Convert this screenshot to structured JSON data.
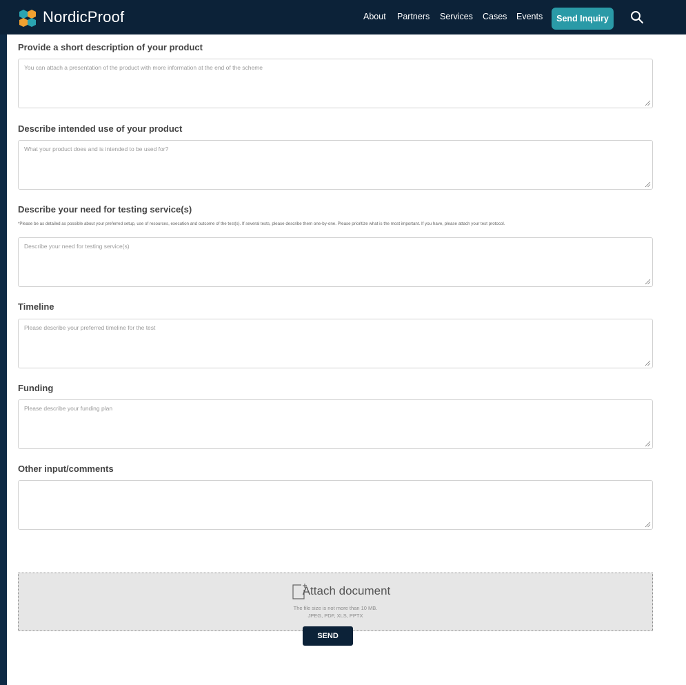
{
  "header": {
    "brand": "NordicProof",
    "nav": [
      "About",
      "Partners",
      "Services",
      "Cases",
      "Events"
    ],
    "cta_label": "Send Inquiry",
    "icons": {
      "logo": "nordicproof-logo-icon",
      "search": "search-icon"
    },
    "colors": {
      "header_bg": "#0c2238",
      "cta_bg": "#2a9aa7",
      "logo_teal": "#2aa4b1",
      "logo_orange": "#f0a030"
    }
  },
  "form": {
    "product_description": {
      "label": "Provide a short description of your product",
      "placeholder": "You can attach a presentation of the product with more information at the end of the scheme",
      "value": ""
    },
    "intended_use": {
      "label": "Describe intended use of your product",
      "placeholder": "What your product does and is intended to be used for?",
      "value": ""
    },
    "testing_need": {
      "label": "Describe your need for testing service(s)",
      "hint": "*Please be as detailed as possible about your preferred setup, use of resources, execution and outcome of the test(s). If several tests, please describe them one-by-one. Please prioritize what is the most important. If you have, please attach your test protocol.",
      "placeholder": "Describe your need for testing service(s)",
      "value": ""
    },
    "timeline": {
      "label": "Timeline",
      "placeholder": "Please describe your preferred timeline for the test",
      "value": ""
    },
    "funding": {
      "label": "Funding",
      "placeholder": "Please describe your funding plan",
      "value": ""
    },
    "other": {
      "label": "Other input/comments",
      "placeholder": "",
      "value": ""
    },
    "attach": {
      "title": "Attach document",
      "size_note": "The file size is not more than 10 MB.",
      "formats": "JPEG, PDF, XLS, PPTX",
      "icon": "attach-document-icon"
    },
    "send_label": "SEND"
  }
}
